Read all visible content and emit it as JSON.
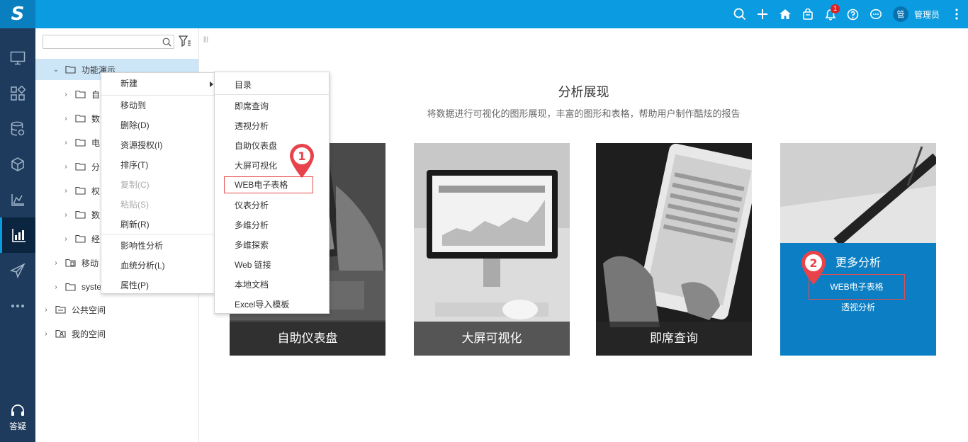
{
  "header": {
    "logo": "S",
    "notification_count": "1",
    "avatar_text": "管",
    "username": "管理员",
    "icons": [
      "search-icon",
      "plus-icon",
      "home-icon",
      "bag-icon",
      "bell-icon",
      "help-circle-icon",
      "chat-icon",
      "more-vertical-icon"
    ]
  },
  "leftnav": {
    "items": [
      "monitor-icon",
      "grid-icon",
      "database-icon",
      "cube-icon",
      "chart-slope-icon",
      "bar-chart-icon",
      "send-icon",
      "ellipsis-icon"
    ],
    "active_index": 5,
    "help_label": "答疑"
  },
  "tree": {
    "search": {
      "value": "",
      "placeholder": ""
    },
    "nodes": [
      {
        "label": "功能演示",
        "level": 1,
        "expanded": true
      },
      {
        "label": "自",
        "level": 2
      },
      {
        "label": "数",
        "level": 2
      },
      {
        "label": "电",
        "level": 2
      },
      {
        "label": "分",
        "level": 2
      },
      {
        "label": "权",
        "level": 2
      },
      {
        "label": "数",
        "level": 2
      },
      {
        "label": "经",
        "level": 2
      },
      {
        "label": "移动",
        "level": 1
      },
      {
        "label": "syste",
        "level": 1
      },
      {
        "label": "公共空间",
        "level": 0
      },
      {
        "label": "我的空间",
        "level": 0
      }
    ]
  },
  "context_menu": {
    "items": [
      {
        "label": "新建",
        "has_submenu": true
      },
      {
        "label": "移动到"
      },
      {
        "label": "删除(D)"
      },
      {
        "label": "资源授权(I)"
      },
      {
        "label": "排序(T)"
      },
      {
        "label": "复制(C)",
        "disabled": true
      },
      {
        "label": "粘贴(S)",
        "disabled": true
      },
      {
        "label": "刷新(R)"
      },
      {
        "label": "影响性分析"
      },
      {
        "label": "血统分析(L)"
      },
      {
        "label": "属性(P)"
      }
    ]
  },
  "submenu": {
    "items": [
      "目录",
      "即席查询",
      "透视分析",
      "自助仪表盘",
      "大屏可视化",
      "WEB电子表格",
      "仪表分析",
      "多维分析",
      "多维探索",
      "Web 链接",
      "本地文档",
      "Excel导入模板"
    ],
    "highlight_index": 5
  },
  "markers": [
    "1",
    "2"
  ],
  "main": {
    "title": "分析展现",
    "subtitle": "将数据进行可视化的图形展现，丰富的图形和表格，帮助用户制作酷炫的报告",
    "cards": [
      {
        "label": "自助仪表盘"
      },
      {
        "label": "大屏可视化"
      },
      {
        "label": "即席查询"
      }
    ],
    "more": {
      "title": "更多分析",
      "link1": "WEB电子表格",
      "link2": "透视分析"
    }
  },
  "colors": {
    "topbar": "#0b9be0",
    "leftnav": "#1e3a5c",
    "highlight_border": "#e64c4c",
    "marker": "#e8434a",
    "more_card": "#0c7fc4"
  }
}
